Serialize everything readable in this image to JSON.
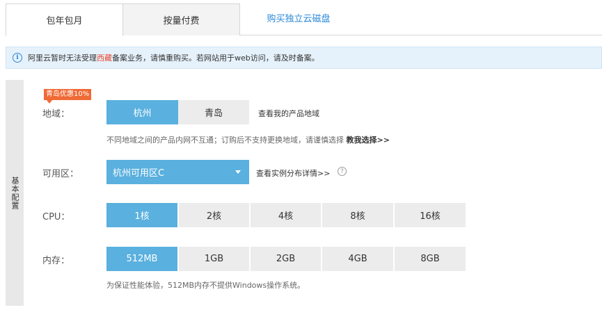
{
  "tabs": [
    {
      "label": "包年包月"
    },
    {
      "label": "按量付费"
    },
    {
      "label": "购买独立云磁盘"
    }
  ],
  "notice": {
    "text_before": "阿里云暂时无法受理",
    "highlight": "西藏",
    "text_after": "备案业务，请慎重购买。若网站用于web访问，请及时备案。"
  },
  "config": {
    "section_label": "基本配置",
    "promo": "青岛优惠10%",
    "region": {
      "label": "地域：",
      "options": [
        "杭州",
        "青岛"
      ],
      "selected": "杭州",
      "link": "查看我的产品地域",
      "hint": "不同地域之间的产品内网不互通；订购后不支持更换地域，请谨慎选择",
      "hint_link": "教我选择>>"
    },
    "zone": {
      "label": "可用区：",
      "selected": "杭州可用区C",
      "link": "查看实例分布详情>>"
    },
    "cpu": {
      "label": "CPU：",
      "options": [
        "1核",
        "2核",
        "4核",
        "8核",
        "16核"
      ],
      "selected": "1核"
    },
    "memory": {
      "label": "内存：",
      "options": [
        "512MB",
        "1GB",
        "2GB",
        "4GB",
        "8GB"
      ],
      "selected": "512MB",
      "hint": "为保证性能体验，512MB内存不提供Windows操作系统。"
    }
  },
  "colors": {
    "accent": "#5ab0de",
    "link": "#2a88d8",
    "promo": "#f06a35",
    "warning_text": "#e8472f"
  }
}
